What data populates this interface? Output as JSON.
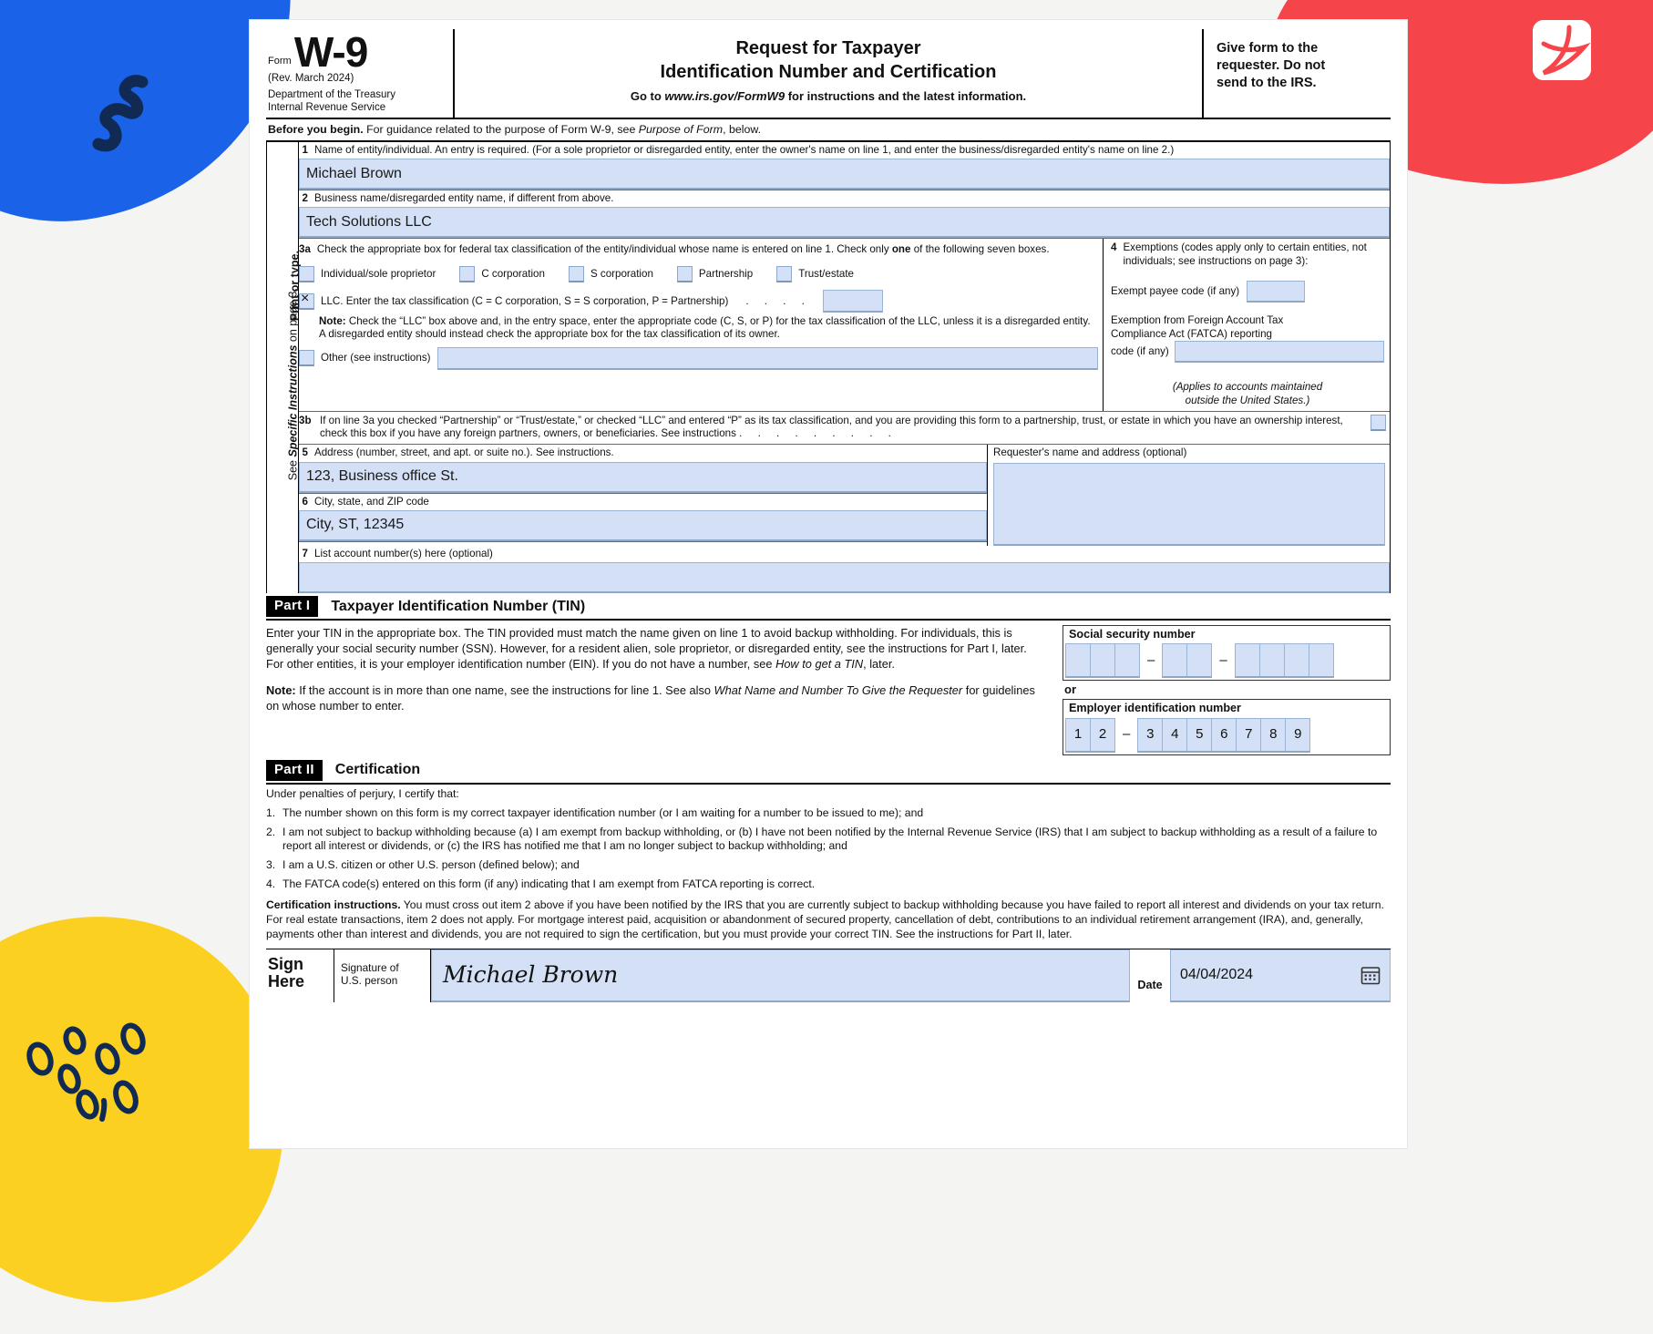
{
  "decor": {
    "blob_blue_color": "#1a62e8",
    "blob_red_color": "#f5444a",
    "blob_yellow_color": "#fbd021",
    "squiggle_color": "#102a54",
    "logo_name": "pdf-logo",
    "page_background": "#f4f4f2"
  },
  "header": {
    "form_word": "Form",
    "form_number": "W-9",
    "revision": "(Rev. March 2024)",
    "department_line1": "Department of the Treasury",
    "department_line2": "Internal Revenue Service",
    "title_line1": "Request for Taxpayer",
    "title_line2": "Identification Number and Certification",
    "goto_prefix": "Go to ",
    "goto_url": "www.irs.gov/FormW9",
    "goto_suffix": " for instructions and the latest information.",
    "give_form_line1": "Give form to the",
    "give_form_line2": "requester. Do not",
    "give_form_line3": "send to the IRS."
  },
  "before_you_begin": {
    "bold": "Before you begin.",
    "text": " For guidance related to the purpose of Form W-9, see ",
    "italic": "Purpose of Form",
    "tail": ", below."
  },
  "sidebar": {
    "line1": "Print or type.",
    "line2_prefix": "See ",
    "line2_italic": "Specific Instructions",
    "line2_suffix": " on page 3."
  },
  "line1": {
    "num": "1",
    "label": "Name of entity/individual. An entry is required. (For a sole proprietor or disregarded entity, enter the owner's name on line 1, and enter the business/disregarded entity's name on line 2.)",
    "value": "Michael Brown"
  },
  "line2": {
    "num": "2",
    "label": "Business name/disregarded entity name, if different from above.",
    "value": "Tech Solutions LLC"
  },
  "line3a": {
    "num": "3a",
    "label_pre": "Check the appropriate box for federal tax classification of the entity/individual whose name is entered on line 1. Check only ",
    "label_bold": "one",
    "label_post": " of the following seven boxes.",
    "options": [
      {
        "label": "Individual/sole proprietor",
        "checked": false
      },
      {
        "label": "C corporation",
        "checked": false
      },
      {
        "label": "S corporation",
        "checked": false
      },
      {
        "label": "Partnership",
        "checked": false
      },
      {
        "label": "Trust/estate",
        "checked": false
      }
    ],
    "llc": {
      "checked": true,
      "label": "LLC. Enter the tax classification (C = C corporation, S = S corporation, P = Partnership)",
      "dots": ". . . .",
      "value": ""
    },
    "note_bold": "Note:",
    "note_text": " Check the “LLC” box above and, in the entry space, enter the appropriate code (C, S, or P) for the tax classification of the LLC, unless it is a disregarded entity. A disregarded entity should instead check the appropriate box for the tax classification of its owner.",
    "other": {
      "label": "Other (see instructions)",
      "checked": false,
      "value": ""
    }
  },
  "line4": {
    "num": "4",
    "label": "Exemptions (codes apply only to certain entities, not individuals; see instructions on page 3):",
    "exempt_payee_label": "Exempt payee code (if any)",
    "exempt_payee_value": "",
    "fatca_label_line1": "Exemption from Foreign Account Tax",
    "fatca_label_line2": "Compliance Act (FATCA) reporting",
    "fatca_label_line3": "code (if any)",
    "fatca_value": "",
    "applies_line1": "(Applies to accounts maintained",
    "applies_line2": "outside the United States.)"
  },
  "line3b": {
    "num": "3b",
    "text": "If on line 3a you checked “Partnership” or “Trust/estate,” or checked “LLC” and entered “P” as its tax classification, and you are providing this form to a partnership, trust, or estate in which you have an ownership interest, check this box if you have any foreign partners, owners, or beneficiaries. See instructions",
    "dots": ". . . . . . . . .",
    "checked": false
  },
  "line5": {
    "num": "5",
    "label": "Address (number, street, and apt. or suite no.). See instructions.",
    "value": "123, Business office St."
  },
  "line6": {
    "num": "6",
    "label": "City, state, and ZIP code",
    "value": "City, ST, 12345"
  },
  "line7": {
    "num": "7",
    "label": "List account number(s) here (optional)",
    "value": ""
  },
  "requester": {
    "label": "Requester's name and address (optional)",
    "value": ""
  },
  "part1": {
    "tag": "Part I",
    "title": "Taxpayer Identification Number (TIN)",
    "para1": "Enter your TIN in the appropriate box. The TIN provided must match the name given on line 1 to avoid backup withholding. For individuals, this is generally your social security number (SSN). However, for a resident alien, sole proprietor, or disregarded entity, see the instructions for Part I, later. For other entities, it is your employer identification number (EIN). If you do not have a number, see ",
    "para1_italic": "How to get a TIN",
    "para1_tail": ", later.",
    "note_bold": "Note:",
    "note_text": " If the account is in more than one name, see the instructions for line 1. See also ",
    "note_italic": "What Name and Number To Give the Requester",
    "note_tail": " for guidelines on whose number to enter.",
    "ssn_label": "Social security number",
    "ssn_digits": [
      "",
      "",
      "",
      "",
      "",
      "",
      "",
      "",
      ""
    ],
    "or": "or",
    "ein_label": "Employer identification number",
    "ein_digits": [
      "1",
      "2",
      "3",
      "4",
      "5",
      "6",
      "7",
      "8",
      "9"
    ],
    "dash": "–"
  },
  "part2": {
    "tag": "Part II",
    "title": "Certification",
    "intro": "Under penalties of perjury, I certify that:",
    "items": [
      {
        "n": "1.",
        "text": "The number shown on this form is my correct taxpayer identification number (or I am waiting for a number to be issued to me); and"
      },
      {
        "n": "2.",
        "text": "I am not subject to backup withholding because (a) I am exempt from backup withholding, or (b) I have not been notified by the Internal Revenue Service (IRS) that I am subject to backup withholding as a result of a failure to report all interest or dividends, or (c) the IRS has notified me that I am no longer subject to backup withholding; and"
      },
      {
        "n": "3.",
        "text": "I am a U.S. citizen or other U.S. person (defined below); and"
      },
      {
        "n": "4.",
        "text": "The FATCA code(s) entered on this form (if any) indicating that I am exempt from FATCA reporting is correct."
      }
    ],
    "cert_bold": "Certification instructions.",
    "cert_text": " You must cross out item 2 above if you have been notified by the IRS that you are currently subject to backup withholding because you have failed to report all interest and dividends on your tax return. For real estate transactions, item 2 does not apply. For mortgage interest paid, acquisition or abandonment of secured property, cancellation of debt, contributions to an individual retirement arrangement (IRA), and, generally, payments other than interest and dividends, you are not required to sign the certification, but you must provide your correct TIN. See the instructions for Part II, later."
  },
  "sign": {
    "sign_here_line1": "Sign",
    "sign_here_line2": "Here",
    "signature_label_line1": "Signature of",
    "signature_label_line2": "U.S. person",
    "signature_value": "Michael Brown",
    "date_label": "Date",
    "date_value": "04/04/2024",
    "calendar_icon": "calendar-icon"
  }
}
